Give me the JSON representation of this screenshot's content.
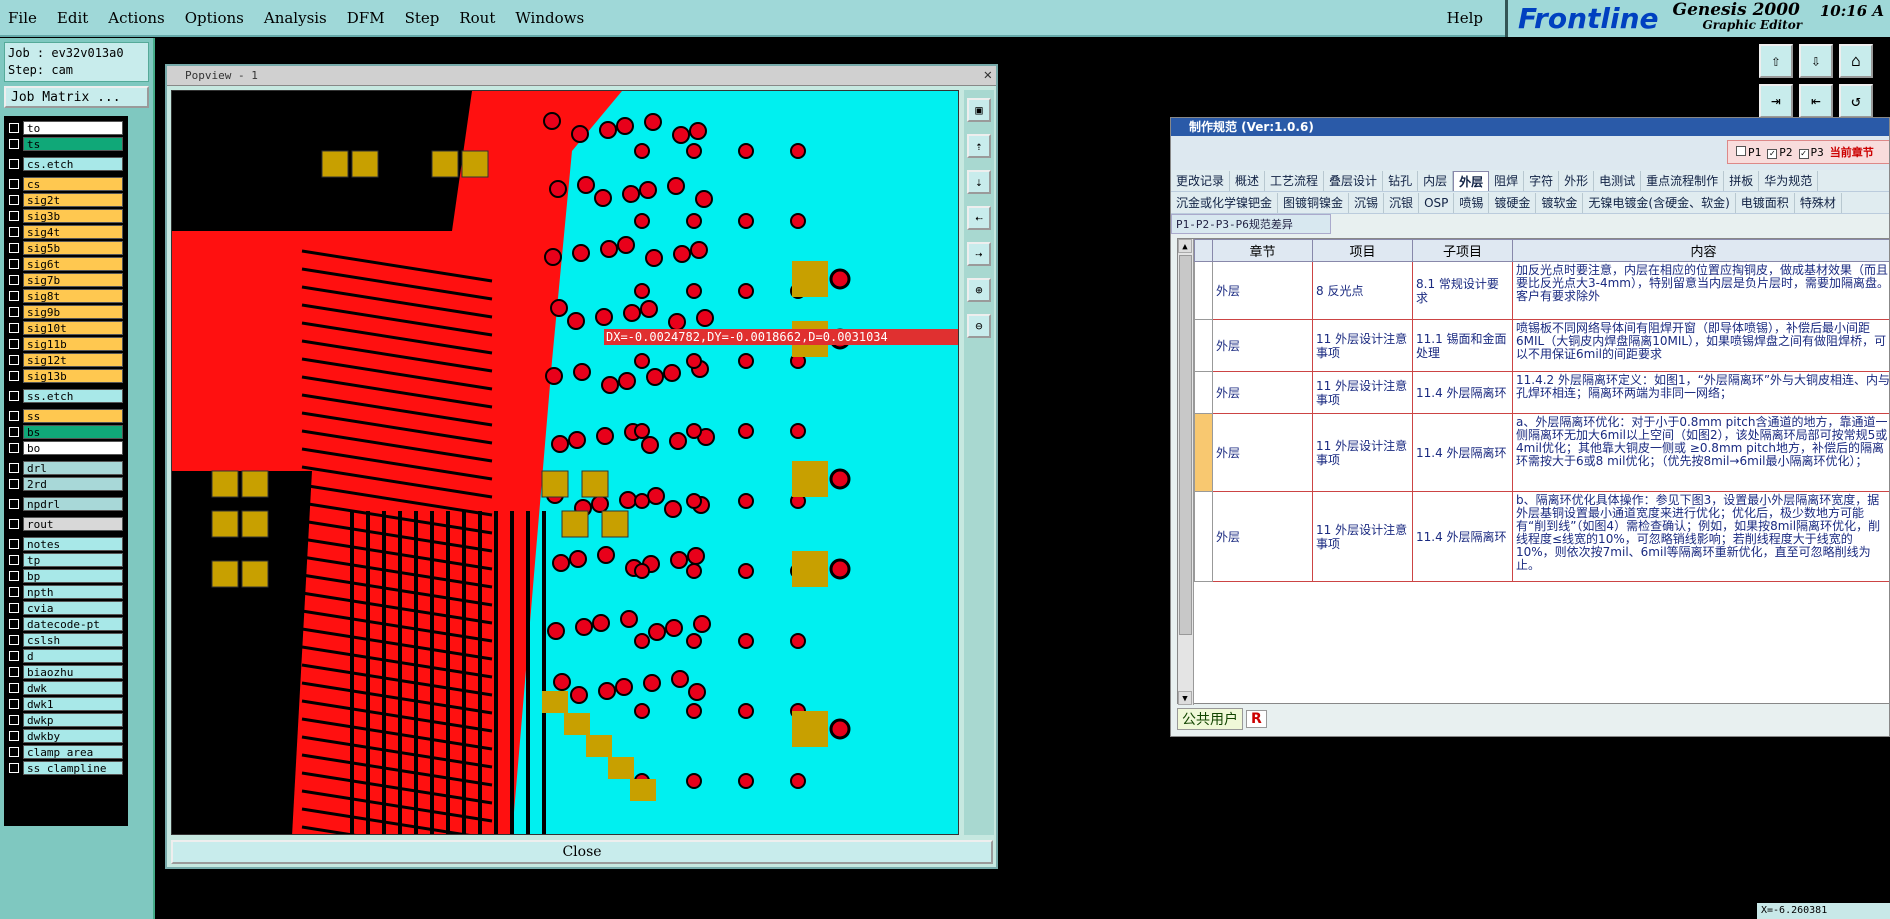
{
  "menubar": {
    "items": [
      "File",
      "Edit",
      "Actions",
      "Options",
      "Analysis",
      "DFM",
      "Step",
      "Rout",
      "Windows"
    ],
    "help": "Help"
  },
  "logo": {
    "brand": "Frontline",
    "product": "Genesis 2000",
    "subtitle": "Graphic Editor",
    "clock": "10:16 A"
  },
  "job": {
    "job_line": "Job : ev32v013a0",
    "step_line": "Step: cam",
    "matrix_button": "Job Matrix ..."
  },
  "layers": [
    {
      "name": "to",
      "color": "#ffffff"
    },
    {
      "name": "ts",
      "color": "#10a878"
    },
    {
      "name": "cs.etch",
      "color": "#a8e8e8",
      "gap": true
    },
    {
      "name": "cs",
      "color": "#ffc850",
      "gap": true
    },
    {
      "name": "sig2t",
      "color": "#ffc850"
    },
    {
      "name": "sig3b",
      "color": "#ffc850"
    },
    {
      "name": "sig4t",
      "color": "#ffc850"
    },
    {
      "name": "sig5b",
      "color": "#ffc850"
    },
    {
      "name": "sig6t",
      "color": "#ffc850"
    },
    {
      "name": "sig7b",
      "color": "#ffc850"
    },
    {
      "name": "sig8t",
      "color": "#ffc850"
    },
    {
      "name": "sig9b",
      "color": "#ffc850"
    },
    {
      "name": "sig10t",
      "color": "#ffc850"
    },
    {
      "name": "sig11b",
      "color": "#ffc850"
    },
    {
      "name": "sig12t",
      "color": "#ffc850"
    },
    {
      "name": "sig13b",
      "color": "#ffc850"
    },
    {
      "name": "ss.etch",
      "color": "#a8e8e8",
      "gap": true
    },
    {
      "name": "ss",
      "color": "#ffc850",
      "gap": true
    },
    {
      "name": "bs",
      "color": "#10a878"
    },
    {
      "name": "bo",
      "color": "#ffffff"
    },
    {
      "name": "drl",
      "color": "#a8d8d8",
      "gap": true
    },
    {
      "name": "2rd",
      "color": "#a8d8d8"
    },
    {
      "name": "npdrl",
      "color": "#a8d8d8",
      "gap": true
    },
    {
      "name": "rout",
      "color": "#d8d8d8",
      "gap": true
    },
    {
      "name": "notes",
      "color": "#a8e8e8",
      "gap": true
    },
    {
      "name": "tp",
      "color": "#a8e8e8"
    },
    {
      "name": "bp",
      "color": "#a8e8e8"
    },
    {
      "name": "npth",
      "color": "#a8e8e8"
    },
    {
      "name": "cvia",
      "color": "#a8e8e8"
    },
    {
      "name": "datecode-pt",
      "color": "#a8e8e8"
    },
    {
      "name": "cslsh",
      "color": "#a8e8e8"
    },
    {
      "name": "d",
      "color": "#a8e8e8"
    },
    {
      "name": "biaozhu",
      "color": "#a8e8e8"
    },
    {
      "name": "dwk",
      "color": "#a8e8e8"
    },
    {
      "name": "dwk1",
      "color": "#a8e8e8"
    },
    {
      "name": "dwkp",
      "color": "#a8e8e8"
    },
    {
      "name": "dwkby",
      "color": "#a8e8e8"
    },
    {
      "name": "clamp_area",
      "color": "#a8e8e8"
    },
    {
      "name": "ss_clampline",
      "color": "#a8e8e8"
    }
  ],
  "popview": {
    "title": "Popview - 1",
    "measurement": "DX=-0.0024782,DY=-0.0018662,D=0.0031034",
    "close_label": "Close"
  },
  "spec": {
    "title": "制作规范 (Ver:1.0.6)",
    "p1": "P1",
    "p2": "P2",
    "p3": "P3",
    "current": "当前章节",
    "tabs_row1": [
      "更改记录",
      "概述",
      "工艺流程",
      "叠层设计",
      "钻孔",
      "内层",
      "外层",
      "阻焊",
      "字符",
      "外形",
      "电测试",
      "重点流程制作",
      "拼板",
      "华为规范"
    ],
    "active_tab": "外层",
    "tabs_row2": [
      "沉金或化学镍钯金",
      "图镀铜镍金",
      "沉锡",
      "沉银",
      "OSP",
      "喷锡",
      "镀硬金",
      "镀软金",
      "无镍电镀金(含硬金、软金)",
      "电镀面积",
      "特殊材"
    ],
    "subtab": "P1-P2-P3-P6规范差异",
    "headers": {
      "chapter": "章节",
      "item": "项目",
      "subitem": "子项目",
      "content": "内容"
    },
    "rows": [
      {
        "chapter": "外层",
        "item": "8 反光点",
        "subitem": "8.1 常规设计要求",
        "content": "加反光点时要注意，内层在相应的位置应掏铜皮，做成基材效果（而且要比反光点大3-4mm），特别留意当内层是负片层时，需要加隔离盘。客户有要求除外"
      },
      {
        "chapter": "外层",
        "item": "11 外层设计注意事项",
        "subitem": "11.1 锡面和金面处理",
        "content": "喷锡板不同网络导体间有阻焊开窗（即导体喷锡），补偿后最小间距6MIL（大铜皮内焊盘隔离10MIL），如果喷锡焊盘之间有做阻焊桥，可以不用保证6mil的间距要求"
      },
      {
        "chapter": "外层",
        "item": "11 外层设计注意事项",
        "subitem": "11.4 外层隔离环",
        "content": "11.4.2 外层隔离环定义：如图1，“外层隔离环”外与大铜皮相连、内与孔焊环相连；隔离环两端为非同一网络；"
      },
      {
        "chapter": "外层",
        "item": "11 外层设计注意事项",
        "subitem": "11.4 外层隔离环",
        "content": "a、外层隔离环优化：对于小于0.8mm pitch含通道的地方，靠通道一侧隔离环无加大6mil以上空间（如图2），该处隔离环局部可按常规5或4mil优化；其他靠大铜皮一侧或 ≥0.8mm pitch地方，补偿后的隔离环需按大于6或8 mil优化；（优先按8mil→6mil最小隔离环优化）；",
        "highlight": true
      },
      {
        "chapter": "外层",
        "item": "11 外层设计注意事项",
        "subitem": "11.4 外层隔离环",
        "content": "b、隔离环优化具体操作：参见下图3，设置最小外层隔离环宽度，据外层基铜设置最小通道宽度来进行优化；优化后，极少数地方可能有“削到线”（如图4）需检查确认；例如，如果按8mil隔离环优化，削线程度≤线宽的10%，可忽略销线影响；若削线程度大于线宽的10%，则依次按7mil、6mil等隔离环重新优化，直至可忽略削线为止。"
      }
    ],
    "status_user": "公共用户",
    "status_r": "R"
  },
  "corner_text": "X=-6.260381"
}
